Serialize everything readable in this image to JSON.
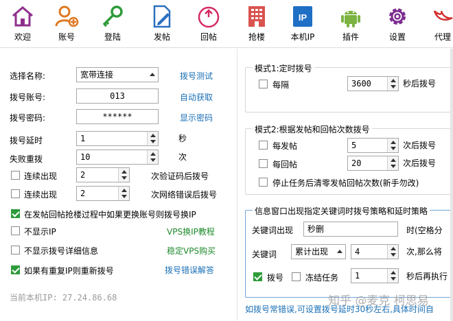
{
  "toolbar": {
    "items": [
      {
        "label": "欢迎",
        "icon": "home-icon"
      },
      {
        "label": "账号",
        "icon": "add-user-icon"
      },
      {
        "label": "登陆",
        "icon": "key-icon"
      },
      {
        "label": "发帖",
        "icon": "edit-document-icon"
      },
      {
        "label": "回帖",
        "icon": "power-icon"
      },
      {
        "label": "抢楼",
        "icon": "building-icon"
      },
      {
        "label": "本机IP",
        "icon": "ip-icon"
      },
      {
        "label": "插件",
        "icon": "android-icon"
      },
      {
        "label": "设置",
        "icon": "gear-icon"
      },
      {
        "label": "代理",
        "icon": "bird-icon"
      }
    ]
  },
  "left": {
    "select_name_label": "选择名称:",
    "select_name_value": "宽带连接",
    "test_dial_link": "拨号测试",
    "account_label": "拨号账号:",
    "account_value": "013",
    "auto_get_link": "自动获取",
    "password_label": "拨号密码:",
    "password_value": "******",
    "show_password_link": "显示密码",
    "delay_label": "拨号延时",
    "delay_value": "1",
    "delay_unit": "秒",
    "retry_label": "失败重拨",
    "retry_value": "10",
    "retry_unit": "次",
    "captcha_label": "连续出现",
    "captcha_value": "2",
    "captcha_suffix": "次验证码后拨号",
    "neterr_label": "连续出现",
    "neterr_value": "2",
    "neterr_suffix": "次网络错误后拨号",
    "switch_ip_label": "在发帖回帖抢楼过程中如果更换账号则拨号换IP",
    "hide_ip_label": "不显示IP",
    "vps_tutorial_link": "VPS换IP教程",
    "hide_detail_label": "不显示拨号详细信息",
    "vps_buy_link": "稳定VPS购买",
    "redial_label": "如果有重复IP则重新拨号",
    "error_help_link": "拨号错误解答",
    "current_ip": "当前本机IP: 27.24.86.68"
  },
  "mode1": {
    "title": "模式1:定时拨号",
    "every_label": "每隔",
    "every_value": "3600",
    "every_suffix": "秒后拨号"
  },
  "mode2": {
    "title": "模式2:根据发帖和回帖次数拨号",
    "post_label": "每发帖",
    "post_value": "5",
    "post_suffix": "次后拨号",
    "reply_label": "每回帖",
    "reply_value": "20",
    "reply_suffix": "次后拨号",
    "clear_label": "停止任务后清零发帖回帖次数(新手勿改)"
  },
  "keyword": {
    "title": "信息窗口出现指定关键词时拨号策略和延时策略",
    "keyword_label": "关键词出现",
    "keyword_value": "秒删",
    "keyword_hint": "时(空格分",
    "kw2_label": "关键词",
    "kw2_combo": "累计出现",
    "kw2_value": "4",
    "kw2_suffix": "次,那么将",
    "dial_label": "拨号",
    "freeze_label": "冻结任务",
    "freeze_value": "1",
    "freeze_suffix": "秒后再执行"
  },
  "note": "如拨号常错误,可设置拨号延时30秒左右,具体时间自",
  "watermark": "知乎 @麦克 柯思易",
  "colors": {
    "accent": "#1a6fb5",
    "green": "#1d8a2c",
    "check": "#2e9b3a"
  }
}
